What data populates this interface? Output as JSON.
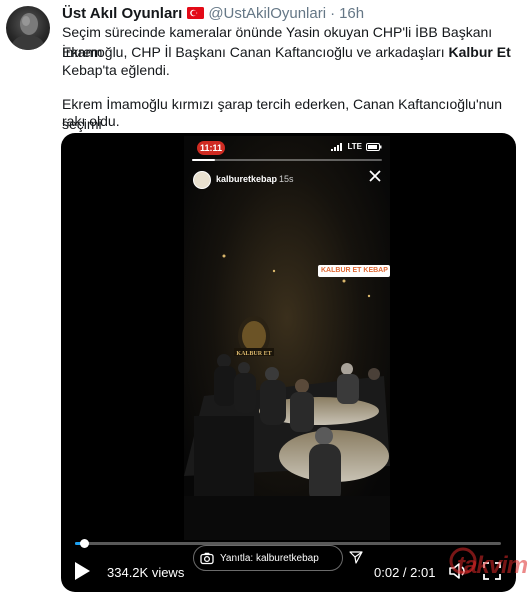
{
  "tweet": {
    "display_name": "Üst Akıl Oyunları",
    "handle": "@UstAkilOyunlari",
    "separator": "·",
    "time": "16h",
    "flag_icon": "turkey-flag",
    "body": {
      "line1": "Seçim sürecinde kameralar önünde Yasin okuyan CHP'li İBB Başkanı Ekrem",
      "line2": "İmamoğlu, CHP İl Başkanı Canan Kaftancıoğlu ve arkadaşları ",
      "line2_bold": "Kalbur Et",
      "line3": " Kebap'ta eğlendi.",
      "para2_line1": "Ekrem İmamoğlu kırmızı şarap tercih ederken, Canan Kaftancıoğlu'nun seçimi",
      "para2_line2": "rakı oldu."
    }
  },
  "video": {
    "story": {
      "status_time": "11:11",
      "network": "LTE",
      "username": "kalburetkebap",
      "elapsed": "15s",
      "location_sticker": "KALBUR ET KEBAP",
      "reply_placeholder": "Yanıtla: kalburetkebap",
      "story_progress": 0.12,
      "sign_text": "KALBUR ET"
    },
    "views": "334.2K views",
    "timestamp": "0:02 / 2:01",
    "seek_progress": 0.02,
    "accent_color": "#1da1f2",
    "icons": [
      "play-icon",
      "volume-icon",
      "fullscreen-icon",
      "camera-icon",
      "send-icon",
      "close-icon"
    ]
  },
  "watermark": {
    "text": "takvim",
    "color": "#dc2828"
  }
}
